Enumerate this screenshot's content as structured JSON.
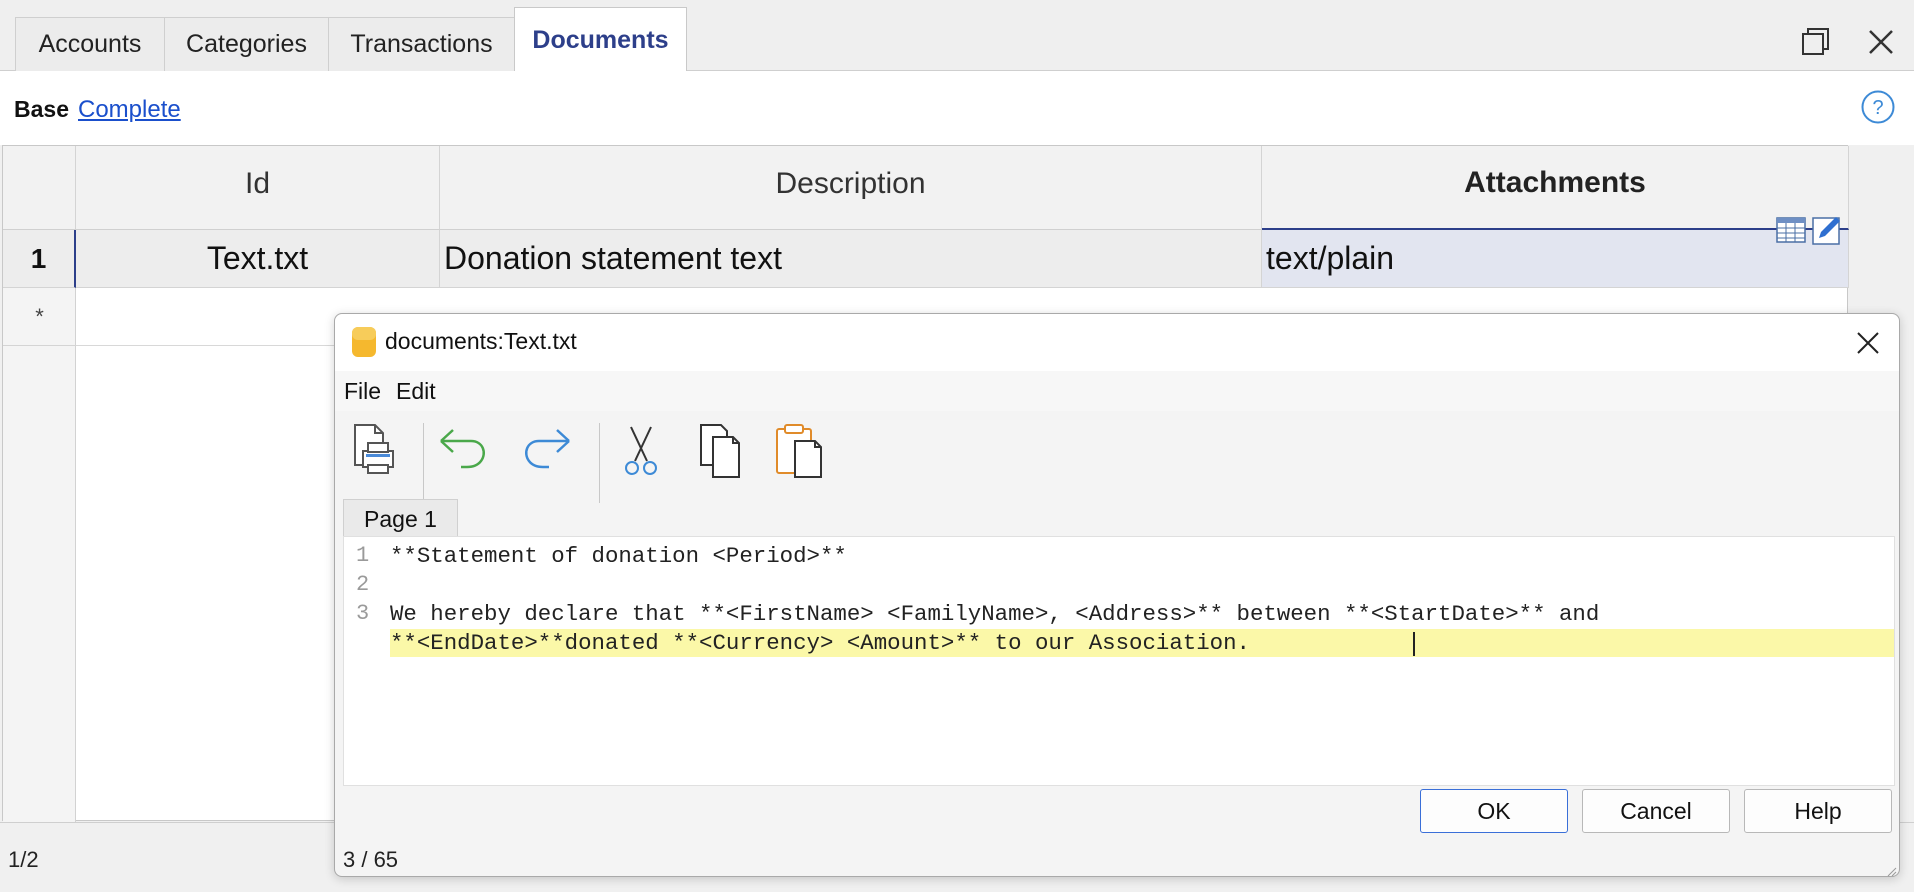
{
  "tabs": [
    "Accounts",
    "Categories",
    "Transactions",
    "Documents"
  ],
  "active_tab": "Documents",
  "views": {
    "base": "Base",
    "complete": "Complete"
  },
  "table": {
    "columns": [
      "Id",
      "Description",
      "Attachments"
    ],
    "rows": [
      {
        "num": "1",
        "id": "Text.txt",
        "description": "Donation statement text",
        "attachments": "text/plain"
      }
    ],
    "new_row_marker": "*"
  },
  "status": {
    "rows": "1/2"
  },
  "dialog": {
    "title": "documents:Text.txt",
    "menu": [
      "File",
      "Edit"
    ],
    "page_tab": "Page 1",
    "lines": [
      {
        "num": "1",
        "text": "**Statement of donation <Period>**"
      },
      {
        "num": "2",
        "text": ""
      },
      {
        "num": "3",
        "text": "We hereby declare that **<FirstName> <FamilyName>, <Address>** between **<StartDate>** and"
      },
      {
        "num": "",
        "text": "**<EndDate>**donated **<Currency> <Amount>** to our Association."
      }
    ],
    "buttons": {
      "ok": "OK",
      "cancel": "Cancel",
      "help": "Help"
    },
    "cursor_position": "3 / 65"
  },
  "colors": {
    "active_tab_text": "#2d3f8a",
    "link": "#1a4fcc",
    "highlight": "#fbf8a8"
  }
}
